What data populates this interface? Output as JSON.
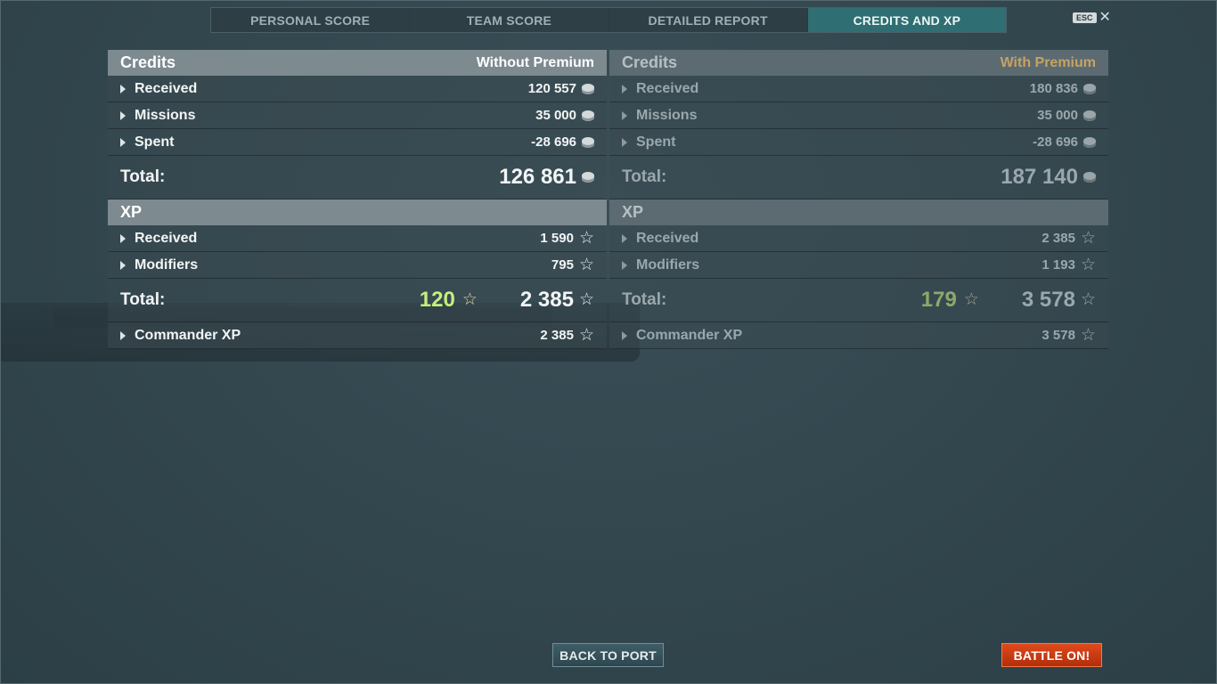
{
  "tabs": [
    {
      "label": "PERSONAL SCORE"
    },
    {
      "label": "TEAM SCORE"
    },
    {
      "label": "DETAILED REPORT"
    },
    {
      "label": "CREDITS AND XP"
    }
  ],
  "esc": {
    "key": "ESC",
    "close": "✕"
  },
  "without_premium": {
    "credits_title": "Credits",
    "header_sub": "Without Premium",
    "credits_rows": [
      {
        "label": "Received",
        "value": "120 557"
      },
      {
        "label": "Missions",
        "value": "35 000"
      },
      {
        "label": "Spent",
        "value": "-28 696"
      }
    ],
    "credits_total_label": "Total:",
    "credits_total": "126 861",
    "xp_title": "XP",
    "xp_rows": [
      {
        "label": "Received",
        "value": "1 590"
      },
      {
        "label": "Modifiers",
        "value": "795"
      }
    ],
    "xp_total_label": "Total:",
    "xp_bonus": "120",
    "xp_total": "2 385",
    "commander_label": "Commander XP",
    "commander_value": "2 385"
  },
  "with_premium": {
    "credits_title": "Credits",
    "header_sub": "With Premium",
    "credits_rows": [
      {
        "label": "Received",
        "value": "180 836"
      },
      {
        "label": "Missions",
        "value": "35 000"
      },
      {
        "label": "Spent",
        "value": "-28 696"
      }
    ],
    "credits_total_label": "Total:",
    "credits_total": "187 140",
    "xp_title": "XP",
    "xp_rows": [
      {
        "label": "Received",
        "value": "2 385"
      },
      {
        "label": "Modifiers",
        "value": "1 193"
      }
    ],
    "xp_total_label": "Total:",
    "xp_bonus": "179",
    "xp_total": "3 578",
    "commander_label": "Commander XP",
    "commander_value": "3 578"
  },
  "buttons": {
    "back_to_port": "BACK TO PORT",
    "battle_on": "BATTLE ON!"
  },
  "colors": {
    "active_tab": "#2f6e72",
    "premium_gold": "#c7a263",
    "battle_button": "#d03c13",
    "bonus_green": "#c4f07a"
  }
}
